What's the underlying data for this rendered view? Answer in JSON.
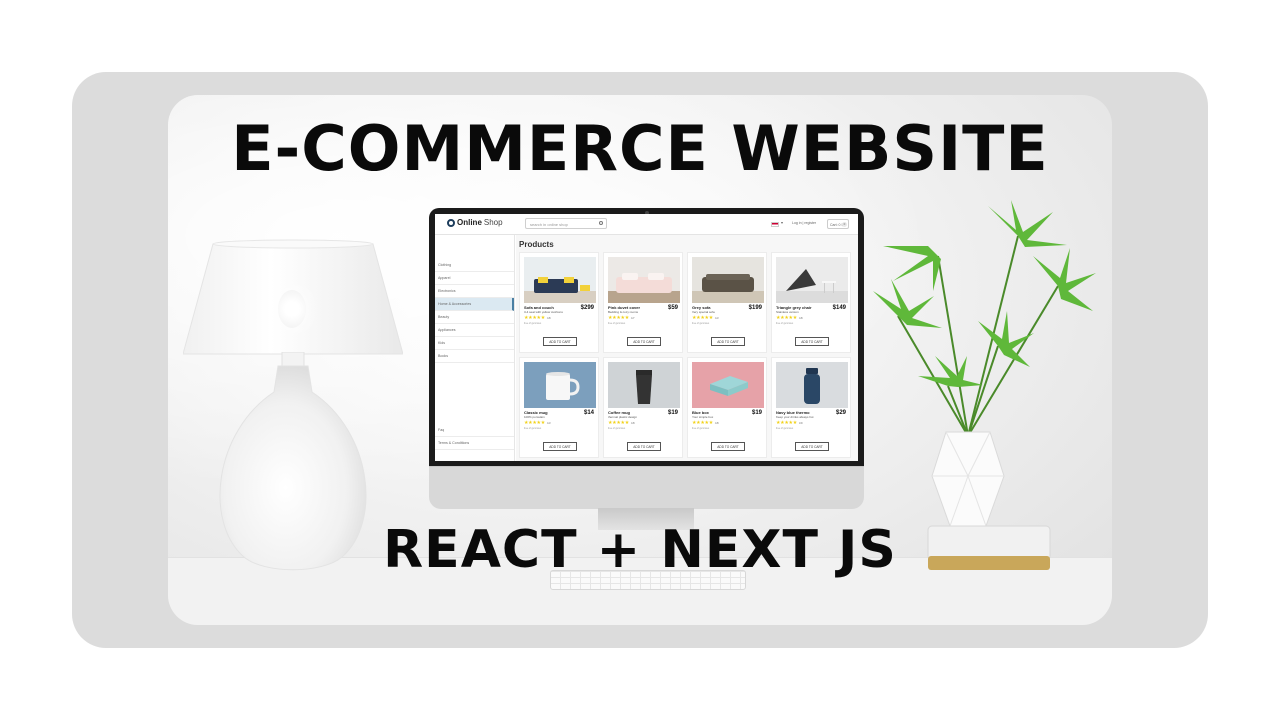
{
  "headline": "E-COMMERCE WEBSITE",
  "subheadline": "REACT + NEXT JS",
  "shop": {
    "logo_bold": "Online",
    "logo_light": "Shop",
    "search_placeholder": "search in online shop",
    "header_links": "Log in   |   register",
    "cart_label": "Cart: 0 $",
    "cart_count": "0",
    "page_title": "Products",
    "categories": [
      "Clothing",
      "Apparel",
      "Electronics",
      "Home & Accessories",
      "Beauty",
      "Appliances",
      "Kids",
      "Books"
    ],
    "active_category": "Home & Accessories",
    "footer_links": [
      "Faq",
      "Terms & Conditions"
    ],
    "add_to_cart_label": "ADD TO CART",
    "products": [
      {
        "name": "Sofa and couch",
        "desc": "3-4 seat with yellow cushions",
        "price": "$299",
        "rating": "4.8",
        "sub": "free of gummies",
        "icon": "sofa-image"
      },
      {
        "name": "Pink duvet cover",
        "desc": "Bedding & cozy rooms",
        "price": "$59",
        "rating": "4.7",
        "sub": "free of gummies",
        "icon": "bed-image"
      },
      {
        "name": "Grey sofa",
        "desc": "Very special sofa",
        "price": "$199",
        "rating": "4.3",
        "sub": "free of gummies",
        "icon": "sofa-image"
      },
      {
        "name": "Triangle grey chair",
        "desc": "Stainless version",
        "price": "$149",
        "rating": "4.8",
        "sub": "free of gummies",
        "icon": "chair-image"
      },
      {
        "name": "Classic mug",
        "desc": "100% porcelain",
        "price": "$14",
        "rating": "4.3",
        "sub": "free of gummies",
        "icon": "mug-image"
      },
      {
        "name": "Coffee mug",
        "desc": "thermal plastic design",
        "price": "$19",
        "rating": "4.8",
        "sub": "free of gummies",
        "icon": "cup-image"
      },
      {
        "name": "Blue box",
        "desc": "Your simple box",
        "price": "$19",
        "rating": "4.8",
        "sub": "free of gummies",
        "icon": "box-image"
      },
      {
        "name": "Navy blue thermo",
        "desc": "Keep your drinks always hot",
        "price": "$29",
        "rating": "3.9",
        "sub": "free of gummies",
        "icon": "thermo-image"
      }
    ]
  }
}
